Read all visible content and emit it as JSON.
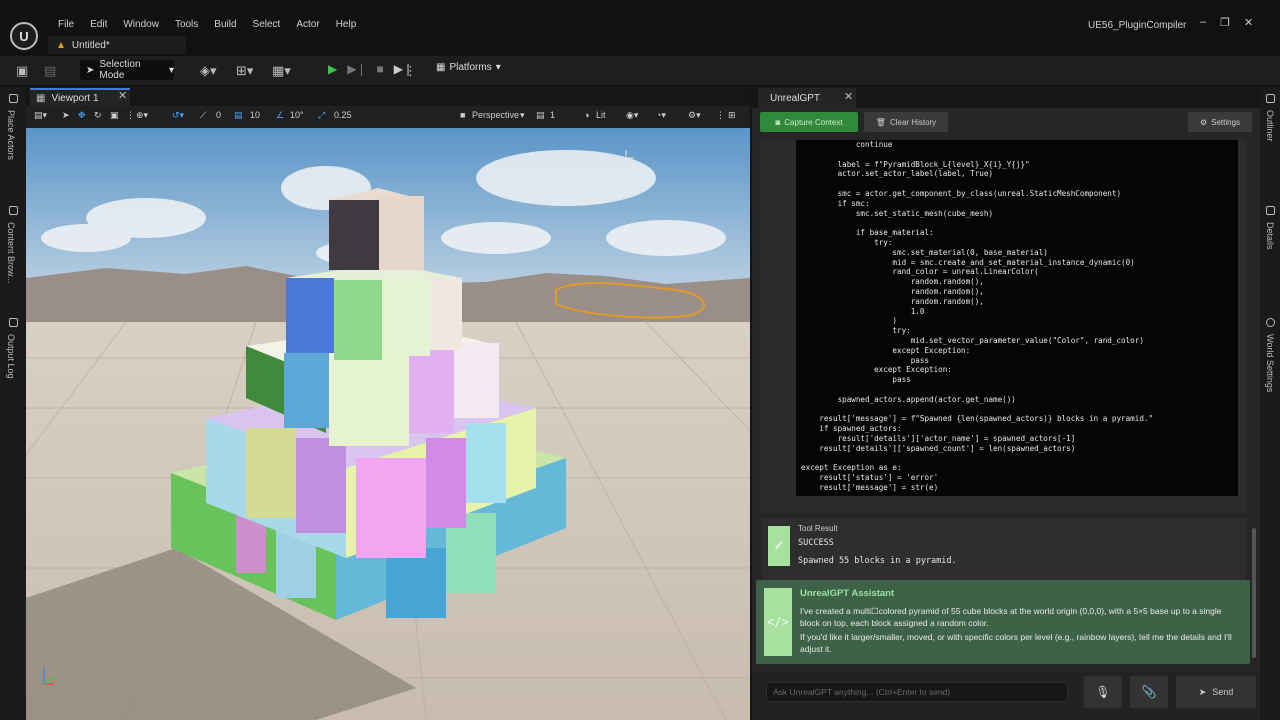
{
  "menubar": {
    "items": [
      "File",
      "Edit",
      "Window",
      "Tools",
      "Build",
      "Select",
      "Actor",
      "Help"
    ],
    "project_name": "UE56_PluginCompiler",
    "doc_tab": "Untitled*"
  },
  "toolbar": {
    "selection_mode": "Selection Mode",
    "platforms": "Platforms"
  },
  "left_tabs": [
    "Place Actors",
    "Content Brow...",
    "Output Log"
  ],
  "right_tabs": [
    "Outliner",
    "Details",
    "World Settings"
  ],
  "viewport": {
    "tab_label": "Viewport 1",
    "snap_rotation": "0",
    "grid_size": "10",
    "rotation_snap": "10°",
    "scale_snap": "0.25",
    "view_mode": "Perspective",
    "layers": "1",
    "lighting": "Lit"
  },
  "gpt": {
    "tab_label": "UnrealGPT",
    "capture_label": "Capture Context",
    "clear_label": "Clear History",
    "settings_label": "Settings",
    "code": "            continue\n\n        label = f\"PyramidBlock_L{level}_X{i}_Y{j}\"\n        actor.set_actor_label(label, True)\n\n        smc = actor.get_component_by_class(unreal.StaticMeshComponent)\n        if smc:\n            smc.set_static_mesh(cube_mesh)\n\n            if base_material:\n                try:\n                    smc.set_material(0, base_material)\n                    mid = smc.create_and_set_material_instance_dynamic(0)\n                    rand_color = unreal.LinearColor(\n                        random.random(),\n                        random.random(),\n                        random.random(),\n                        1.0\n                    )\n                    try:\n                        mid.set_vector_parameter_value(\"Color\", rand_color)\n                    except Exception:\n                        pass\n                except Exception:\n                    pass\n\n        spawned_actors.append(actor.get_name())\n\n    result['message'] = f\"Spawned {len(spawned_actors)} blocks in a pyramid.\"\n    if spawned_actors:\n        result['details']['actor_name'] = spawned_actors[-1]\n    result['details']['spawned_count'] = len(spawned_actors)\n\nexcept Exception as e:\n    result['status'] = 'error'\n    result['message'] = str(e)",
    "tool_result": {
      "title": "Tool Result",
      "status": "SUCCESS",
      "message": "Spawned 55 blocks in a pyramid."
    },
    "assistant": {
      "title": "UnrealGPT Assistant",
      "text1": "I've created a multi☐colored pyramid of 55 cube blocks at the world origin (0,0,0), with a 5×5 base up to a single block on top, each block assigned a random color.",
      "text2": "If you'd like it larger/smaller, moved, or with specific colors per level (e.g., rainbow layers), tell me the details and I'll adjust it."
    },
    "input_placeholder": "Ask UnrealGPT anything... (Ctrl+Enter to send)",
    "send_label": "Send"
  },
  "colors": {
    "accent_blue": "#3b7dd8",
    "capture_green": "#2f8a3c",
    "assistant_bg": "#3d6247",
    "assistant_title": "#9be0a3"
  }
}
